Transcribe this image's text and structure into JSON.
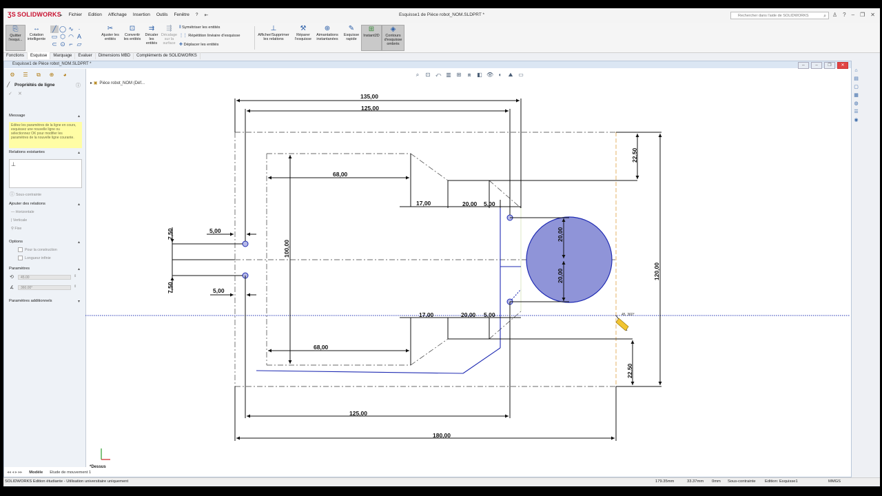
{
  "title_bar": {
    "app_name": "SOLIDWORKS",
    "menus": [
      "Fichier",
      "Edition",
      "Affichage",
      "Insertion",
      "Outils",
      "Fenêtre",
      "?"
    ],
    "document_title": "Esquisse1 de Pièce robot_NOM.SLDPRT *",
    "help_search_placeholder": "Rechercher dans l'aide de SOLIDWORKS"
  },
  "command_manager": {
    "exit_sketch": "Quitter l'esqui...",
    "smart_dimension": "Cotation intelligente",
    "trim_entities": "Ajuster les entités",
    "convert_entities": "Convertir les entités",
    "offset_entities": "Décaler les entités",
    "offset_on_surface": "Décalage sur la surface",
    "mirror_entities": "Symétriser les entités",
    "linear_pattern": "Répétition linéaire d'esquisse",
    "move_entities": "Déplacer les entités",
    "display_delete_relations": "Afficher/Supprimer les relations",
    "repair_sketch": "Réparer l'esquisse",
    "quick_snaps": "Aimantations instantanées",
    "rapid_sketch": "Esquisse rapide",
    "instant2d": "Instant2D",
    "shaded_contours": "Contours d'esquisse ombrés"
  },
  "tabs": [
    "Fonctions",
    "Esquisse",
    "Marquage",
    "Evaluer",
    "Dimensions MBD",
    "Compléments de SOLIDWORKS"
  ],
  "active_tab": "Esquisse",
  "doc_window_title": "Esquisse1 de Pièce robot_NOM.SLDPRT *",
  "tree_root": "Pièce robot_NOM  (Déf...",
  "property_manager": {
    "title": "Propriétés de ligne",
    "message_header": "Message",
    "message_text": "Editez les paramètres de la ligne en cours, esquissez une nouvelle ligne ou sélectionnez OK pour modifier les paramètres de la nouvelle ligne courante.",
    "existing_relations_header": "Relations existantes",
    "under_defined": "Sous-contrainte",
    "add_relations_header": "Ajouter des relations",
    "relations": [
      "Horizontale",
      "Verticale",
      "Fixe"
    ],
    "options_header": "Options",
    "options": [
      "Pour la construction",
      "Longueur infinie"
    ],
    "parameters_header": "Paramètres",
    "length_value": "45.00",
    "angle_value": "360.00°",
    "additional_parameters_header": "Paramètres additionnels"
  },
  "drawing": {
    "dimensions": {
      "overall_top": "135,00",
      "inner_top": "125,00",
      "upper_slot_width": "68,00",
      "upper_17": "17,00",
      "upper_20": "20,00",
      "upper_5": "5,00",
      "upper_right_offset": "22,50",
      "left_hole_top": "7,50",
      "left_hole_top_offset": "5,00",
      "slot_height": "100,00",
      "left_hole_bottom": "7,50",
      "left_hole_bottom_offset": "5,00",
      "circle_upper": "20,00",
      "circle_lower": "20,00",
      "overall_height": "120,00",
      "lower_17": "17,00",
      "lower_20": "20,00",
      "lower_5": "5,00",
      "lower_slot_width": "68,00",
      "lower_right_offset": "22,50",
      "bottom_inner": "125,00",
      "overall_bottom": "180,00"
    },
    "cursor_readout": "45, 360°",
    "view_label": "*Dessus"
  },
  "bottom_tabs": [
    "Modèle",
    "Etude de mouvement 1"
  ],
  "active_bottom_tab": "Modèle",
  "status_bar": {
    "edition": "SOLIDWORKS Edition étudiante - Utilisation universitaire uniquement",
    "x_coord": "179.35mm",
    "y_coord": "33.37mm",
    "z_coord": "0mm",
    "state": "Sous-contrainte",
    "editing": "Edition: Esquisse1",
    "units": "MMGS"
  },
  "colors": {
    "sketch_blue": "#1f2bb3",
    "construction_blue": "#2c37c9",
    "circle_fill": "#8f94d8",
    "dimension_black": "#111111",
    "centerline_orange": "#e0a040",
    "brand_red": "#c8102e"
  }
}
